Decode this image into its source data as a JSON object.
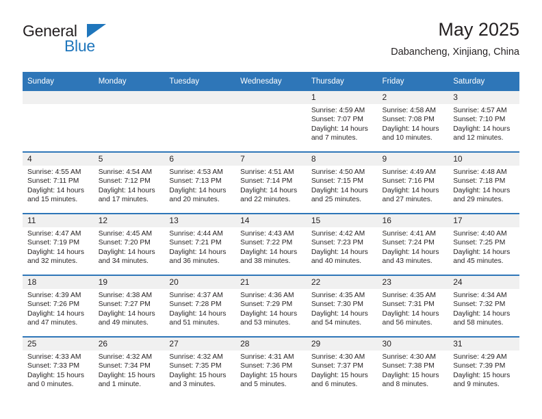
{
  "brand": {
    "name_part1": "General",
    "name_part2": "Blue",
    "triangle_color": "#1f76bc"
  },
  "header": {
    "title": "May 2025",
    "subtitle": "Dabancheng, Xinjiang, China",
    "accent_color": "#2e76b8",
    "daynum_band_color": "#f0f0f0"
  },
  "weekday_headers": [
    "Sunday",
    "Monday",
    "Tuesday",
    "Wednesday",
    "Thursday",
    "Friday",
    "Saturday"
  ],
  "labels": {
    "sunrise": "Sunrise:",
    "sunset": "Sunset:",
    "daylight": "Daylight:"
  },
  "weeks": [
    [
      {
        "day": "",
        "empty": true
      },
      {
        "day": "",
        "empty": true
      },
      {
        "day": "",
        "empty": true
      },
      {
        "day": "",
        "empty": true
      },
      {
        "day": "1",
        "sunrise": "Sunrise: 4:59 AM",
        "sunset": "Sunset: 7:07 PM",
        "daylight_l1": "Daylight: 14 hours",
        "daylight_l2": "and 7 minutes."
      },
      {
        "day": "2",
        "sunrise": "Sunrise: 4:58 AM",
        "sunset": "Sunset: 7:08 PM",
        "daylight_l1": "Daylight: 14 hours",
        "daylight_l2": "and 10 minutes."
      },
      {
        "day": "3",
        "sunrise": "Sunrise: 4:57 AM",
        "sunset": "Sunset: 7:10 PM",
        "daylight_l1": "Daylight: 14 hours",
        "daylight_l2": "and 12 minutes."
      }
    ],
    [
      {
        "day": "4",
        "sunrise": "Sunrise: 4:55 AM",
        "sunset": "Sunset: 7:11 PM",
        "daylight_l1": "Daylight: 14 hours",
        "daylight_l2": "and 15 minutes."
      },
      {
        "day": "5",
        "sunrise": "Sunrise: 4:54 AM",
        "sunset": "Sunset: 7:12 PM",
        "daylight_l1": "Daylight: 14 hours",
        "daylight_l2": "and 17 minutes."
      },
      {
        "day": "6",
        "sunrise": "Sunrise: 4:53 AM",
        "sunset": "Sunset: 7:13 PM",
        "daylight_l1": "Daylight: 14 hours",
        "daylight_l2": "and 20 minutes."
      },
      {
        "day": "7",
        "sunrise": "Sunrise: 4:51 AM",
        "sunset": "Sunset: 7:14 PM",
        "daylight_l1": "Daylight: 14 hours",
        "daylight_l2": "and 22 minutes."
      },
      {
        "day": "8",
        "sunrise": "Sunrise: 4:50 AM",
        "sunset": "Sunset: 7:15 PM",
        "daylight_l1": "Daylight: 14 hours",
        "daylight_l2": "and 25 minutes."
      },
      {
        "day": "9",
        "sunrise": "Sunrise: 4:49 AM",
        "sunset": "Sunset: 7:16 PM",
        "daylight_l1": "Daylight: 14 hours",
        "daylight_l2": "and 27 minutes."
      },
      {
        "day": "10",
        "sunrise": "Sunrise: 4:48 AM",
        "sunset": "Sunset: 7:18 PM",
        "daylight_l1": "Daylight: 14 hours",
        "daylight_l2": "and 29 minutes."
      }
    ],
    [
      {
        "day": "11",
        "sunrise": "Sunrise: 4:47 AM",
        "sunset": "Sunset: 7:19 PM",
        "daylight_l1": "Daylight: 14 hours",
        "daylight_l2": "and 32 minutes."
      },
      {
        "day": "12",
        "sunrise": "Sunrise: 4:45 AM",
        "sunset": "Sunset: 7:20 PM",
        "daylight_l1": "Daylight: 14 hours",
        "daylight_l2": "and 34 minutes."
      },
      {
        "day": "13",
        "sunrise": "Sunrise: 4:44 AM",
        "sunset": "Sunset: 7:21 PM",
        "daylight_l1": "Daylight: 14 hours",
        "daylight_l2": "and 36 minutes."
      },
      {
        "day": "14",
        "sunrise": "Sunrise: 4:43 AM",
        "sunset": "Sunset: 7:22 PM",
        "daylight_l1": "Daylight: 14 hours",
        "daylight_l2": "and 38 minutes."
      },
      {
        "day": "15",
        "sunrise": "Sunrise: 4:42 AM",
        "sunset": "Sunset: 7:23 PM",
        "daylight_l1": "Daylight: 14 hours",
        "daylight_l2": "and 40 minutes."
      },
      {
        "day": "16",
        "sunrise": "Sunrise: 4:41 AM",
        "sunset": "Sunset: 7:24 PM",
        "daylight_l1": "Daylight: 14 hours",
        "daylight_l2": "and 43 minutes."
      },
      {
        "day": "17",
        "sunrise": "Sunrise: 4:40 AM",
        "sunset": "Sunset: 7:25 PM",
        "daylight_l1": "Daylight: 14 hours",
        "daylight_l2": "and 45 minutes."
      }
    ],
    [
      {
        "day": "18",
        "sunrise": "Sunrise: 4:39 AM",
        "sunset": "Sunset: 7:26 PM",
        "daylight_l1": "Daylight: 14 hours",
        "daylight_l2": "and 47 minutes."
      },
      {
        "day": "19",
        "sunrise": "Sunrise: 4:38 AM",
        "sunset": "Sunset: 7:27 PM",
        "daylight_l1": "Daylight: 14 hours",
        "daylight_l2": "and 49 minutes."
      },
      {
        "day": "20",
        "sunrise": "Sunrise: 4:37 AM",
        "sunset": "Sunset: 7:28 PM",
        "daylight_l1": "Daylight: 14 hours",
        "daylight_l2": "and 51 minutes."
      },
      {
        "day": "21",
        "sunrise": "Sunrise: 4:36 AM",
        "sunset": "Sunset: 7:29 PM",
        "daylight_l1": "Daylight: 14 hours",
        "daylight_l2": "and 53 minutes."
      },
      {
        "day": "22",
        "sunrise": "Sunrise: 4:35 AM",
        "sunset": "Sunset: 7:30 PM",
        "daylight_l1": "Daylight: 14 hours",
        "daylight_l2": "and 54 minutes."
      },
      {
        "day": "23",
        "sunrise": "Sunrise: 4:35 AM",
        "sunset": "Sunset: 7:31 PM",
        "daylight_l1": "Daylight: 14 hours",
        "daylight_l2": "and 56 minutes."
      },
      {
        "day": "24",
        "sunrise": "Sunrise: 4:34 AM",
        "sunset": "Sunset: 7:32 PM",
        "daylight_l1": "Daylight: 14 hours",
        "daylight_l2": "and 58 minutes."
      }
    ],
    [
      {
        "day": "25",
        "sunrise": "Sunrise: 4:33 AM",
        "sunset": "Sunset: 7:33 PM",
        "daylight_l1": "Daylight: 15 hours",
        "daylight_l2": "and 0 minutes."
      },
      {
        "day": "26",
        "sunrise": "Sunrise: 4:32 AM",
        "sunset": "Sunset: 7:34 PM",
        "daylight_l1": "Daylight: 15 hours",
        "daylight_l2": "and 1 minute."
      },
      {
        "day": "27",
        "sunrise": "Sunrise: 4:32 AM",
        "sunset": "Sunset: 7:35 PM",
        "daylight_l1": "Daylight: 15 hours",
        "daylight_l2": "and 3 minutes."
      },
      {
        "day": "28",
        "sunrise": "Sunrise: 4:31 AM",
        "sunset": "Sunset: 7:36 PM",
        "daylight_l1": "Daylight: 15 hours",
        "daylight_l2": "and 5 minutes."
      },
      {
        "day": "29",
        "sunrise": "Sunrise: 4:30 AM",
        "sunset": "Sunset: 7:37 PM",
        "daylight_l1": "Daylight: 15 hours",
        "daylight_l2": "and 6 minutes."
      },
      {
        "day": "30",
        "sunrise": "Sunrise: 4:30 AM",
        "sunset": "Sunset: 7:38 PM",
        "daylight_l1": "Daylight: 15 hours",
        "daylight_l2": "and 8 minutes."
      },
      {
        "day": "31",
        "sunrise": "Sunrise: 4:29 AM",
        "sunset": "Sunset: 7:39 PM",
        "daylight_l1": "Daylight: 15 hours",
        "daylight_l2": "and 9 minutes."
      }
    ]
  ]
}
